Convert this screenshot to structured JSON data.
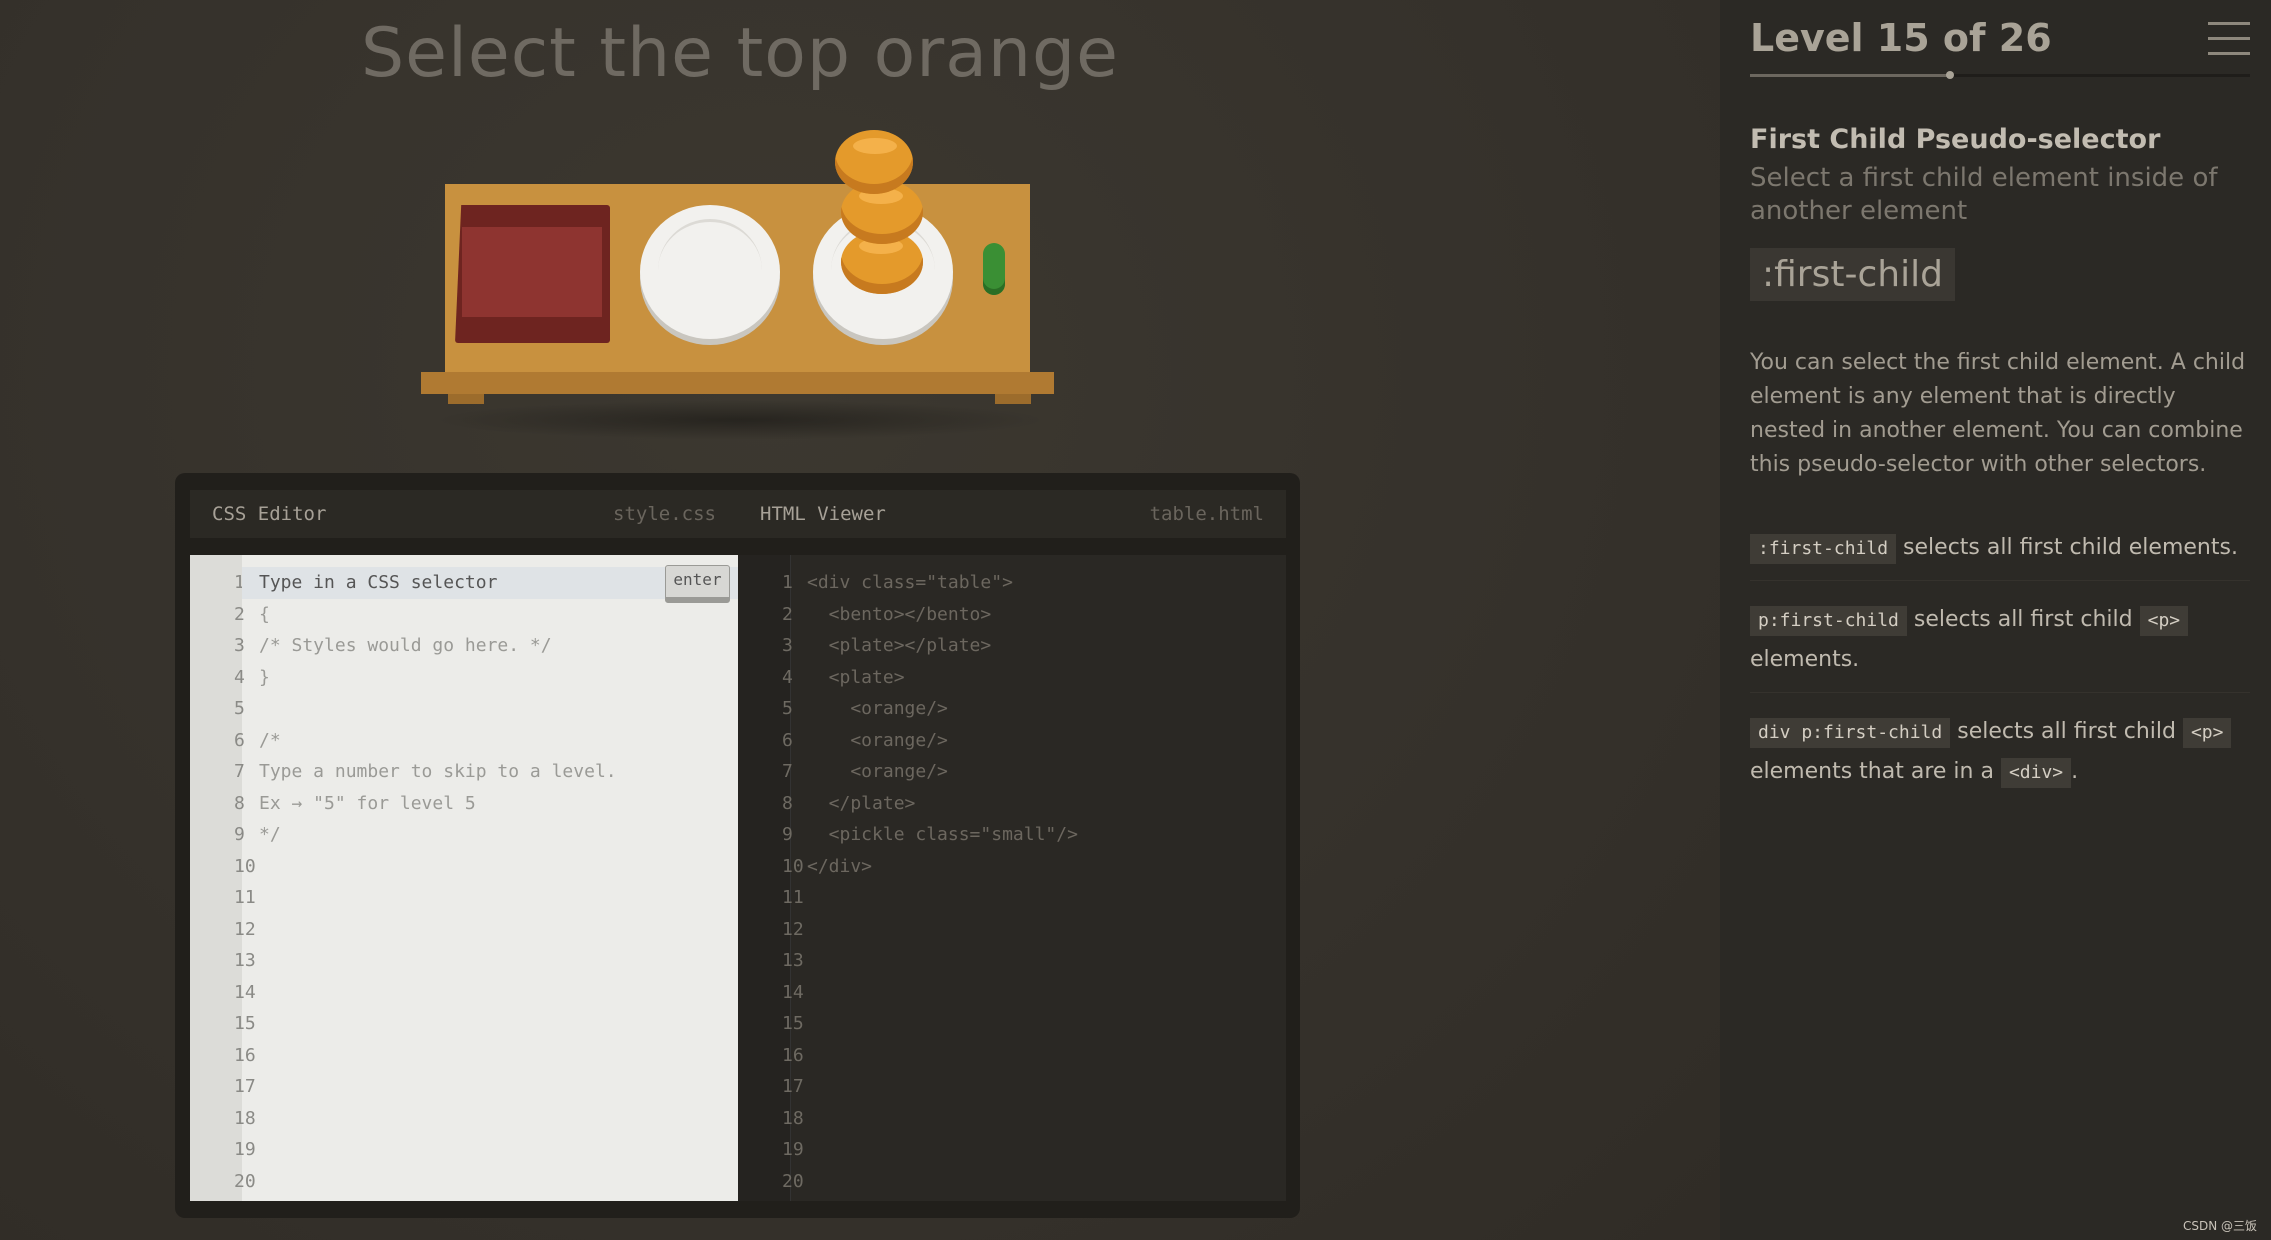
{
  "main": {
    "order_text": "Select the top orange"
  },
  "css_editor": {
    "title": "CSS Editor",
    "file": "style.css",
    "placeholder": "Type in a CSS selector",
    "enter_label": "enter",
    "lines": [
      "1",
      "2",
      "3",
      "4",
      "5",
      "6",
      "7",
      "8",
      "9",
      "10",
      "11",
      "12",
      "13",
      "14",
      "15",
      "16",
      "17",
      "18",
      "19",
      "20"
    ],
    "code_lines": [
      "",
      "{",
      "/* Styles would go here. */",
      "}",
      "",
      "/*",
      "Type a number to skip to a level.",
      "Ex → \"5\" for level 5",
      "*/"
    ]
  },
  "html_viewer": {
    "title": "HTML Viewer",
    "file": "table.html",
    "lines": [
      "1",
      "2",
      "3",
      "4",
      "5",
      "6",
      "7",
      "8",
      "9",
      "10",
      "11",
      "12",
      "13",
      "14",
      "15",
      "16",
      "17",
      "18",
      "19",
      "20"
    ],
    "code_lines": [
      "<div class=\"table\">",
      "  <bento></bento>",
      "  <plate></plate>",
      "  <plate>",
      "    <orange/>",
      "    <orange/>",
      "    <orange/>",
      "  </plate>",
      "  <pickle class=\"small\"/>",
      "</div>"
    ]
  },
  "sidebar": {
    "level_text": "Level 15 of 26",
    "progress": 0.4,
    "selector_name": "First Child Pseudo-selector",
    "title": "Select a first child element inside of another element",
    "syntax": ":first-child",
    "hint": "You can select the first child element. A child element is any element that is directly nested in another element. You can combine this pseudo-selector with other selectors.",
    "examples": [
      {
        "code": ":first-child",
        "text": "selects all first child elements."
      },
      {
        "code": "p:first-child",
        "text_a": "selects all first child",
        "tag": "<p>",
        "text_b": "elements."
      },
      {
        "code": "div p:first-child",
        "text_a": "selects all first child",
        "tag": "<p>",
        "text_b": "elements that are in a",
        "tag2": "<div>",
        "end": "."
      }
    ]
  },
  "watermark": "CSDN @三饭",
  "colors": {
    "orange": "#e49a2b",
    "bento": "#6e2420",
    "table": "#c8913f",
    "pickle": "#3a8f34",
    "plate": "#f2f1ee"
  }
}
